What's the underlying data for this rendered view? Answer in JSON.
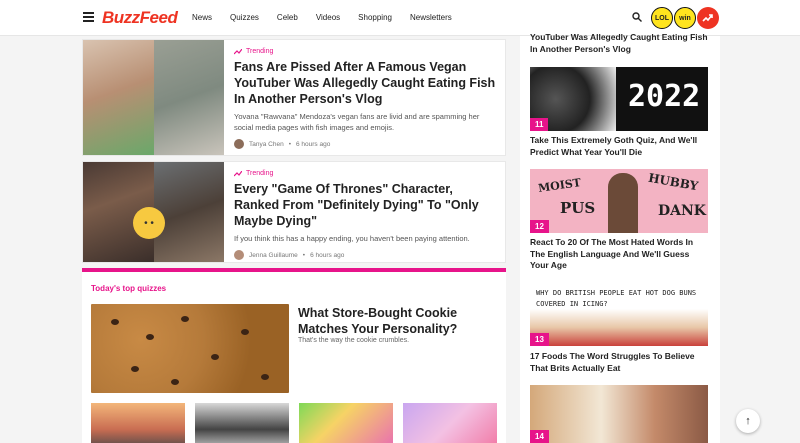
{
  "header": {
    "logo": "BuzzFeed",
    "nav": [
      "News",
      "Quizzes",
      "Celeb",
      "Videos",
      "Shopping",
      "Newsletters"
    ],
    "badges": {
      "lol": "LOL",
      "win": "win"
    }
  },
  "articles": [
    {
      "tag": "Trending",
      "headline": "Fans Are Pissed After A Famous Vegan YouTuber Was Allegedly Caught Eating Fish In Another Person's Vlog",
      "desc": "Yovana \"Rawvana\" Mendoza's vegan fans are livid and are spamming her social media pages with fish images and emojis.",
      "author": "Tanya Chen",
      "time": "6 hours ago"
    },
    {
      "tag": "Trending",
      "headline": "Every \"Game Of Thrones\" Character, Ranked From \"Definitely Dying\" To \"Only Maybe Dying\"",
      "desc": "If you think this has a happy ending, you haven't been paying attention.",
      "author": "Jenna Guillaume",
      "time": "6 hours ago"
    }
  ],
  "quizzes": {
    "section_title": "Today's top quizzes",
    "main_title": "What Store-Bought Cookie Matches Your Personality?",
    "main_sub": "That's the way the cookie crumbles."
  },
  "sidebar": {
    "top_text": "YouTuber Was Allegedly Caught Eating Fish In Another Person's Vlog",
    "items": [
      {
        "rank": "11",
        "text": "Take This Extremely Goth Quiz, And We'll Predict What Year You'll Die",
        "img_text": "2022"
      },
      {
        "rank": "12",
        "text": "React To 20 Of The Most Hated Words In The English Language And We'll Guess Your Age",
        "img_words": [
          "MOIST",
          "HUBBY",
          "PUS",
          "DANK"
        ]
      },
      {
        "rank": "13",
        "text": "17 Foods The Word Struggles To Believe That Brits Actually Eat",
        "img_text": "WHY DO BRITISH PEOPLE EAT HOT DOG BUNS COVERED IN ICING?"
      },
      {
        "rank": "14",
        "text": ""
      }
    ]
  },
  "back_to_top": "↑"
}
